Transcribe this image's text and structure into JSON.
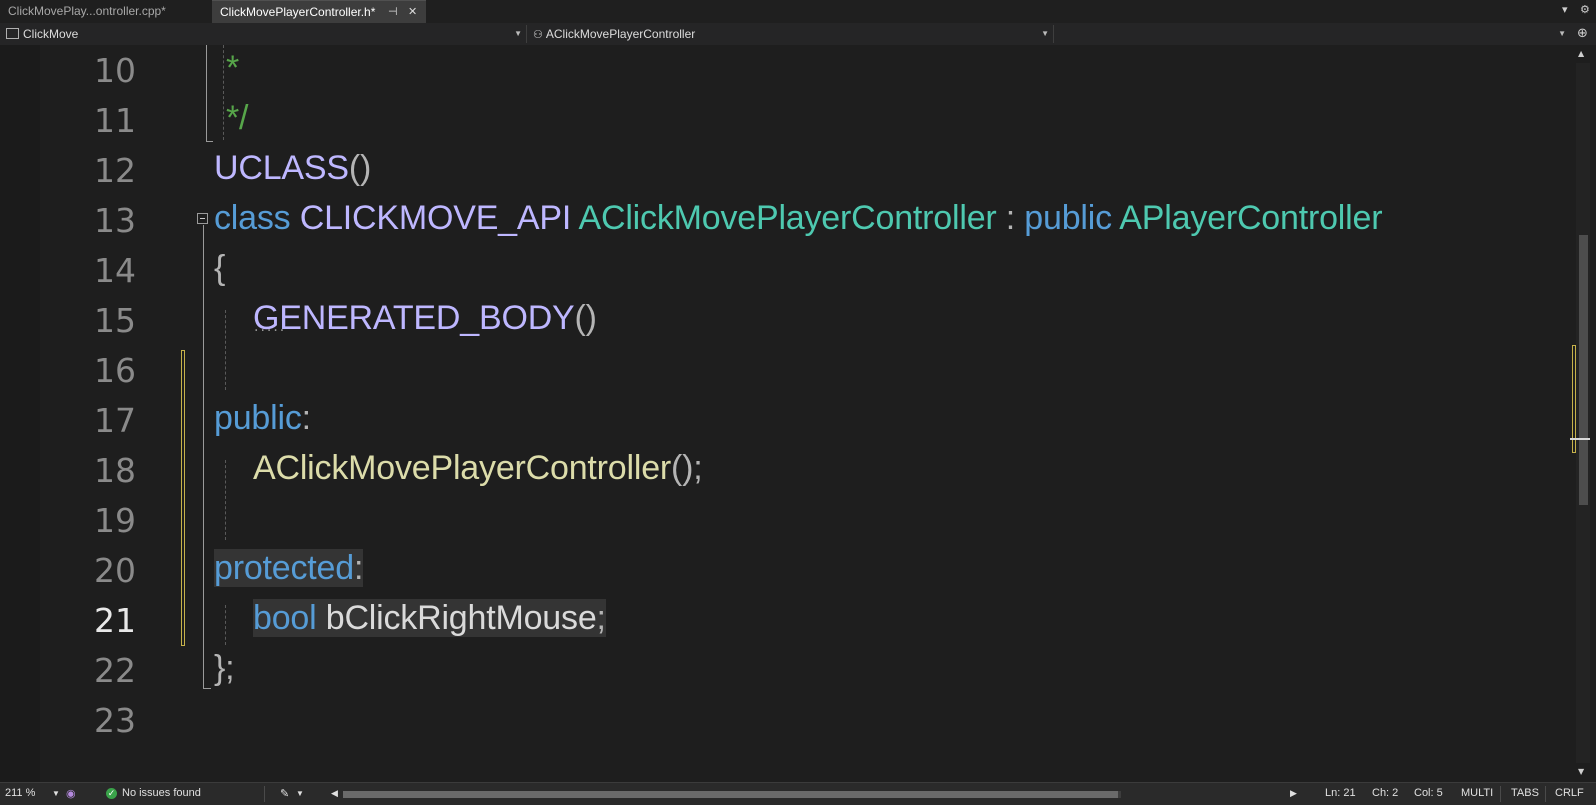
{
  "tabs": [
    {
      "label": "ClickMovePlay...ontroller.cpp*",
      "active": false
    },
    {
      "label": "ClickMovePlayerController.h*",
      "active": true,
      "pin_icon": "pin-icon",
      "close_icon": "close-icon"
    }
  ],
  "nav": {
    "project": "ClickMove",
    "scope": "AClickMovePlayerController",
    "member": ""
  },
  "lines": [
    {
      "num": "10",
      "code": "*"
    },
    {
      "num": "11",
      "code": "*/"
    },
    {
      "num": "12",
      "code": "UCLASS()"
    },
    {
      "num": "13",
      "code": "class CLICKMOVE_API AClickMovePlayerController : public APlayerController"
    },
    {
      "num": "14",
      "code": "{"
    },
    {
      "num": "15",
      "code": "GENERATED_BODY()"
    },
    {
      "num": "16",
      "code": ""
    },
    {
      "num": "17",
      "code": "public:"
    },
    {
      "num": "18",
      "code": "AClickMovePlayerController();"
    },
    {
      "num": "19",
      "code": ""
    },
    {
      "num": "20",
      "code": "protected:"
    },
    {
      "num": "21",
      "code": "bool bClickRightMouse;"
    },
    {
      "num": "22",
      "code": "};"
    },
    {
      "num": "23",
      "code": ""
    }
  ],
  "tokens": {
    "l10_star": "*",
    "l11_end": "*/",
    "l12_uclass": "UCLASS",
    "l12_paren": "()",
    "l13_class": "class",
    "l13_api": "CLICKMOVE_API",
    "l13_name": "AClickMovePlayerController",
    "l13_colon": " : ",
    "l13_public": "public",
    "l13_base": "APlayerController",
    "l14_brace": "{",
    "l15_macro": "GENERATED_BODY",
    "l15_paren": "()",
    "l17_public": "public",
    "l17_colon": ":",
    "l18_ctor": "AClickMovePlayerController",
    "l18_rest": "();",
    "l20_protected": "protected",
    "l20_colon": ":",
    "l21_bool": "bool",
    "l21_var": "bClickRightMouse",
    "l21_semi": ";",
    "l22_close": "};"
  },
  "colors": {
    "keyword": "#569cd6",
    "macro": "#beb7ff",
    "type": "#4ec9b0",
    "function": "#dcdcaa",
    "comment": "#57a64a",
    "change_marker": "#c6b24a"
  },
  "status": {
    "zoom": "211 %",
    "issues": "No issues found",
    "ln": "Ln: 21",
    "ch": "Ch: 2",
    "col": "Col: 5",
    "multi": "MULTI",
    "tabs": "TABS",
    "crlf": "CRLF"
  }
}
